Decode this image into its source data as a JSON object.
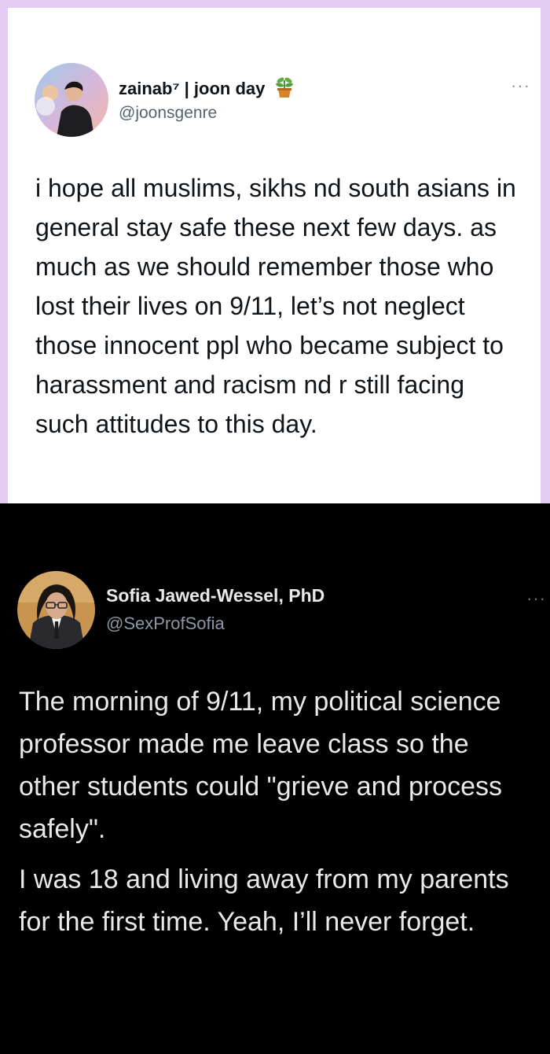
{
  "tweets": [
    {
      "display_name": "zainab⁷ | joon day",
      "handle": "@joonsgenre",
      "name_emoji": "potted-plant-icon",
      "more_label": "···",
      "text": "i hope all muslims, sikhs nd south asians in general stay safe these next few days. as much as we should remember those who lost their lives on 9/11, let’s not neglect those innocent ppl who became subject to harassment and racism nd r still facing such attitudes to this day.",
      "theme": "light",
      "border_color": "#e5caf2"
    },
    {
      "display_name": "Sofia Jawed-Wessel, PhD",
      "handle": "@SexProfSofia",
      "more_label": "···",
      "paragraph1": "The morning of 9/11, my political science professor made me leave class so the other students could \"grieve and process safely\".",
      "paragraph2": "I was 18 and living away from my parents for the first time. Yeah, I’ll never forget.",
      "theme": "dark"
    }
  ]
}
